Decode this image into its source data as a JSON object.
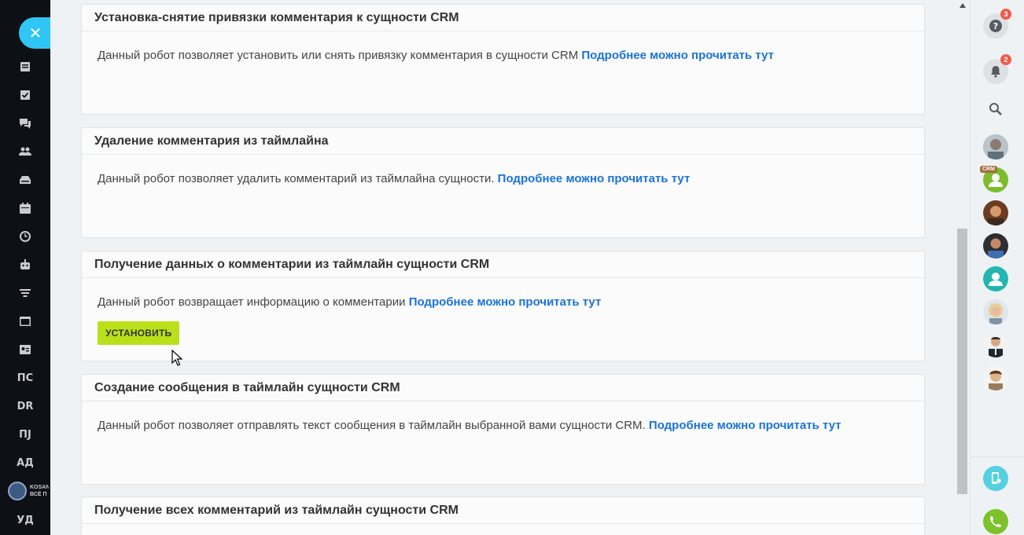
{
  "sidebar": {
    "text_items": [
      "ПС",
      "DR",
      "ПJ",
      "АД",
      "УД"
    ],
    "brand_lines": [
      "KOSAN",
      "ВСЁ П"
    ]
  },
  "cards": [
    {
      "title": "Установка-снятие привязки комментария к сущности CRM",
      "text": "Данный робот позволяет установить или снять привязку комментария в сущности CRM",
      "link": "Подробнее можно прочитать тут"
    },
    {
      "title": "Удаление комментария из таймлайна",
      "text": "Данный робот позволяет удалить комментарий из таймлайна сущности.",
      "link": "Подробнее можно прочитать тут"
    },
    {
      "title": "Получение данных о комментарии из таймлайн сущности CRM",
      "text": "Данный робот возвращает информацию о комментарии",
      "link": "Подробнее можно прочитать тут",
      "button": "УСТАНОВИТЬ"
    },
    {
      "title": "Создание сообщения в таймлайн сущности CRM",
      "text": "Данный робот позволяет отправлять текст сообщения в таймлайн выбранной вами сущности CRM.",
      "link": "Подробнее можно прочитать тут"
    },
    {
      "title": "Получение всех комментарий из таймлайн сущности CRM"
    }
  ],
  "right_panel": {
    "help_badge": "3",
    "notifications_badge": "2",
    "crm_tag": "CRM"
  },
  "colors": {
    "accent_link": "#1a73d9",
    "install_button": "#b9e11b",
    "close_button": "#2fc6f6",
    "badge": "#f05a4b"
  }
}
